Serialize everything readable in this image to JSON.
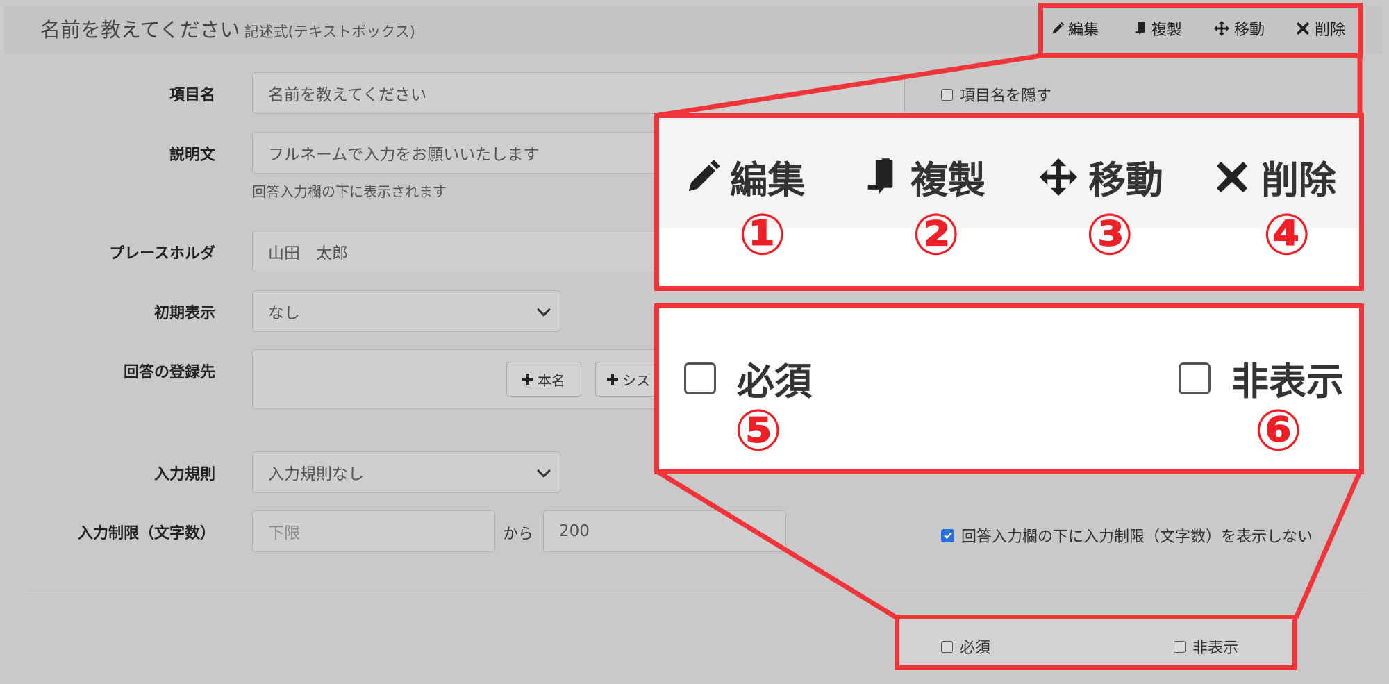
{
  "header": {
    "title": "名前を教えてください",
    "subtitle": "記述式(テキストボックス)"
  },
  "toolbar": {
    "edit": "編集",
    "copy": "複製",
    "move": "移動",
    "delete": "削除"
  },
  "form": {
    "item_name": {
      "label": "項目名",
      "value": "名前を教えてください"
    },
    "hide_item_name": {
      "label": "項目名を隠す",
      "checked": false
    },
    "description": {
      "label": "説明文",
      "value": "フルネームで入力をお願いいたします",
      "help": "回答入力欄の下に表示されます"
    },
    "placeholder": {
      "label": "プレースホルダ",
      "value": "山田　太郎"
    },
    "initial_display": {
      "label": "初期表示",
      "selected": "なし"
    },
    "register_to": {
      "label": "回答の登録先",
      "buttons": [
        "本名",
        "シス"
      ]
    },
    "input_rule": {
      "label": "入力規則",
      "selected": "入力規則なし"
    },
    "char_limit": {
      "label": "入力制限（文字数）",
      "min_placeholder": "下限",
      "from_text": "から",
      "max_value": "200"
    },
    "hide_limit": {
      "label": "回答入力欄の下に入力制限（文字数）を表示しない",
      "checked": true
    }
  },
  "footer": {
    "required": {
      "label": "必須",
      "checked": false
    },
    "hidden": {
      "label": "非表示",
      "checked": false
    }
  },
  "callout": {
    "numbers": [
      "①",
      "②",
      "③",
      "④",
      "⑤",
      "⑥"
    ]
  },
  "colors": {
    "highlight": "#f0353a",
    "number": "#ee1f27",
    "checkbox_checked": "#2a6fd6"
  },
  "icons": [
    "pencil-icon",
    "copy-icon",
    "move-icon",
    "close-icon",
    "plus-icon"
  ]
}
